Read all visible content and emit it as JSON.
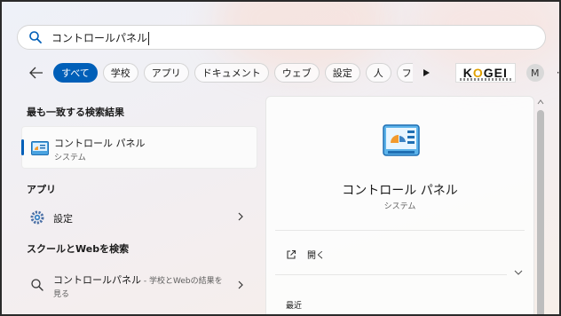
{
  "search": {
    "query": "コントロールパネル"
  },
  "filters": {
    "chips": [
      "すべて",
      "学校",
      "アプリ",
      "ドキュメント",
      "ウェブ",
      "設定",
      "人",
      "フ"
    ],
    "logo_text_left": "K",
    "logo_text_oo": "O",
    "logo_text_right": "GEI",
    "avatar_letter": "M",
    "more": "···"
  },
  "left": {
    "best_match_heading": "最も一致する検索結果",
    "best": {
      "title": "コントロール パネル",
      "subtitle": "システム"
    },
    "apps_heading": "アプリ",
    "settings_item": "設定",
    "web_heading": "スクールとWebを検索",
    "web_item": {
      "title": "コントロールパネル",
      "hint": " - 学校とWebの結果を",
      "line2": "見る"
    }
  },
  "panel": {
    "title": "コントロール パネル",
    "subtitle": "システム",
    "open_label": "開く",
    "recent_label": "最近"
  },
  "colors": {
    "accent": "#005fb8"
  }
}
